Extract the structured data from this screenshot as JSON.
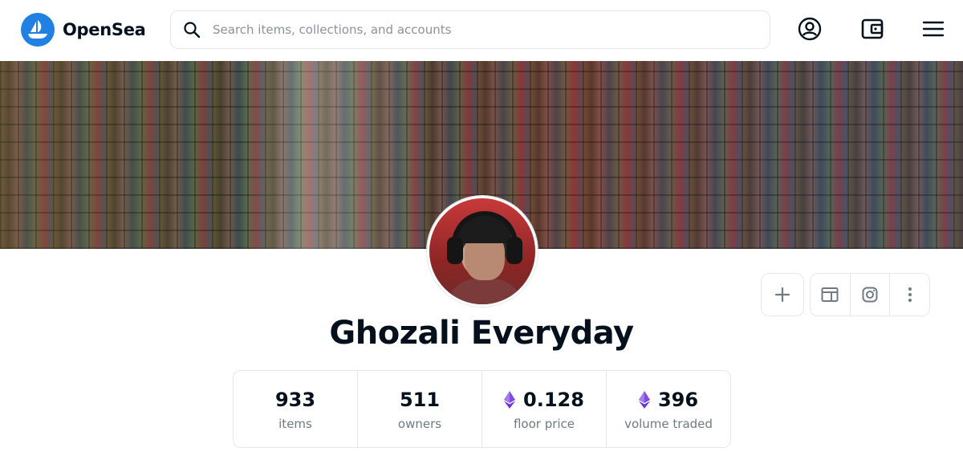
{
  "header": {
    "brand_name": "OpenSea",
    "search_placeholder": "Search items, collections, and accounts",
    "icons": {
      "logo": "opensea-logo-icon",
      "search": "search-icon",
      "account": "account-icon",
      "wallet": "wallet-icon",
      "menu": "hamburger-menu-icon"
    }
  },
  "collection": {
    "name": "Ghozali Everyday",
    "banner": "photo-grid-banner",
    "avatar": "profile-avatar"
  },
  "actions": {
    "icons": [
      "add-icon",
      "website-icon",
      "instagram-icon",
      "more-options-icon"
    ]
  },
  "stats": [
    {
      "value": "933",
      "label": "items",
      "currency_icon": ""
    },
    {
      "value": "511",
      "label": "owners",
      "currency_icon": ""
    },
    {
      "value": "0.128",
      "label": "floor price",
      "currency_icon": "ethereum-icon"
    },
    {
      "value": "396",
      "label": "volume traded",
      "currency_icon": "ethereum-icon"
    }
  ],
  "colors": {
    "brand": "#2081e2",
    "text_primary": "#04111d",
    "text_secondary": "#707a83",
    "border": "#e5e8eb",
    "eth_purple": "#8247e5"
  }
}
